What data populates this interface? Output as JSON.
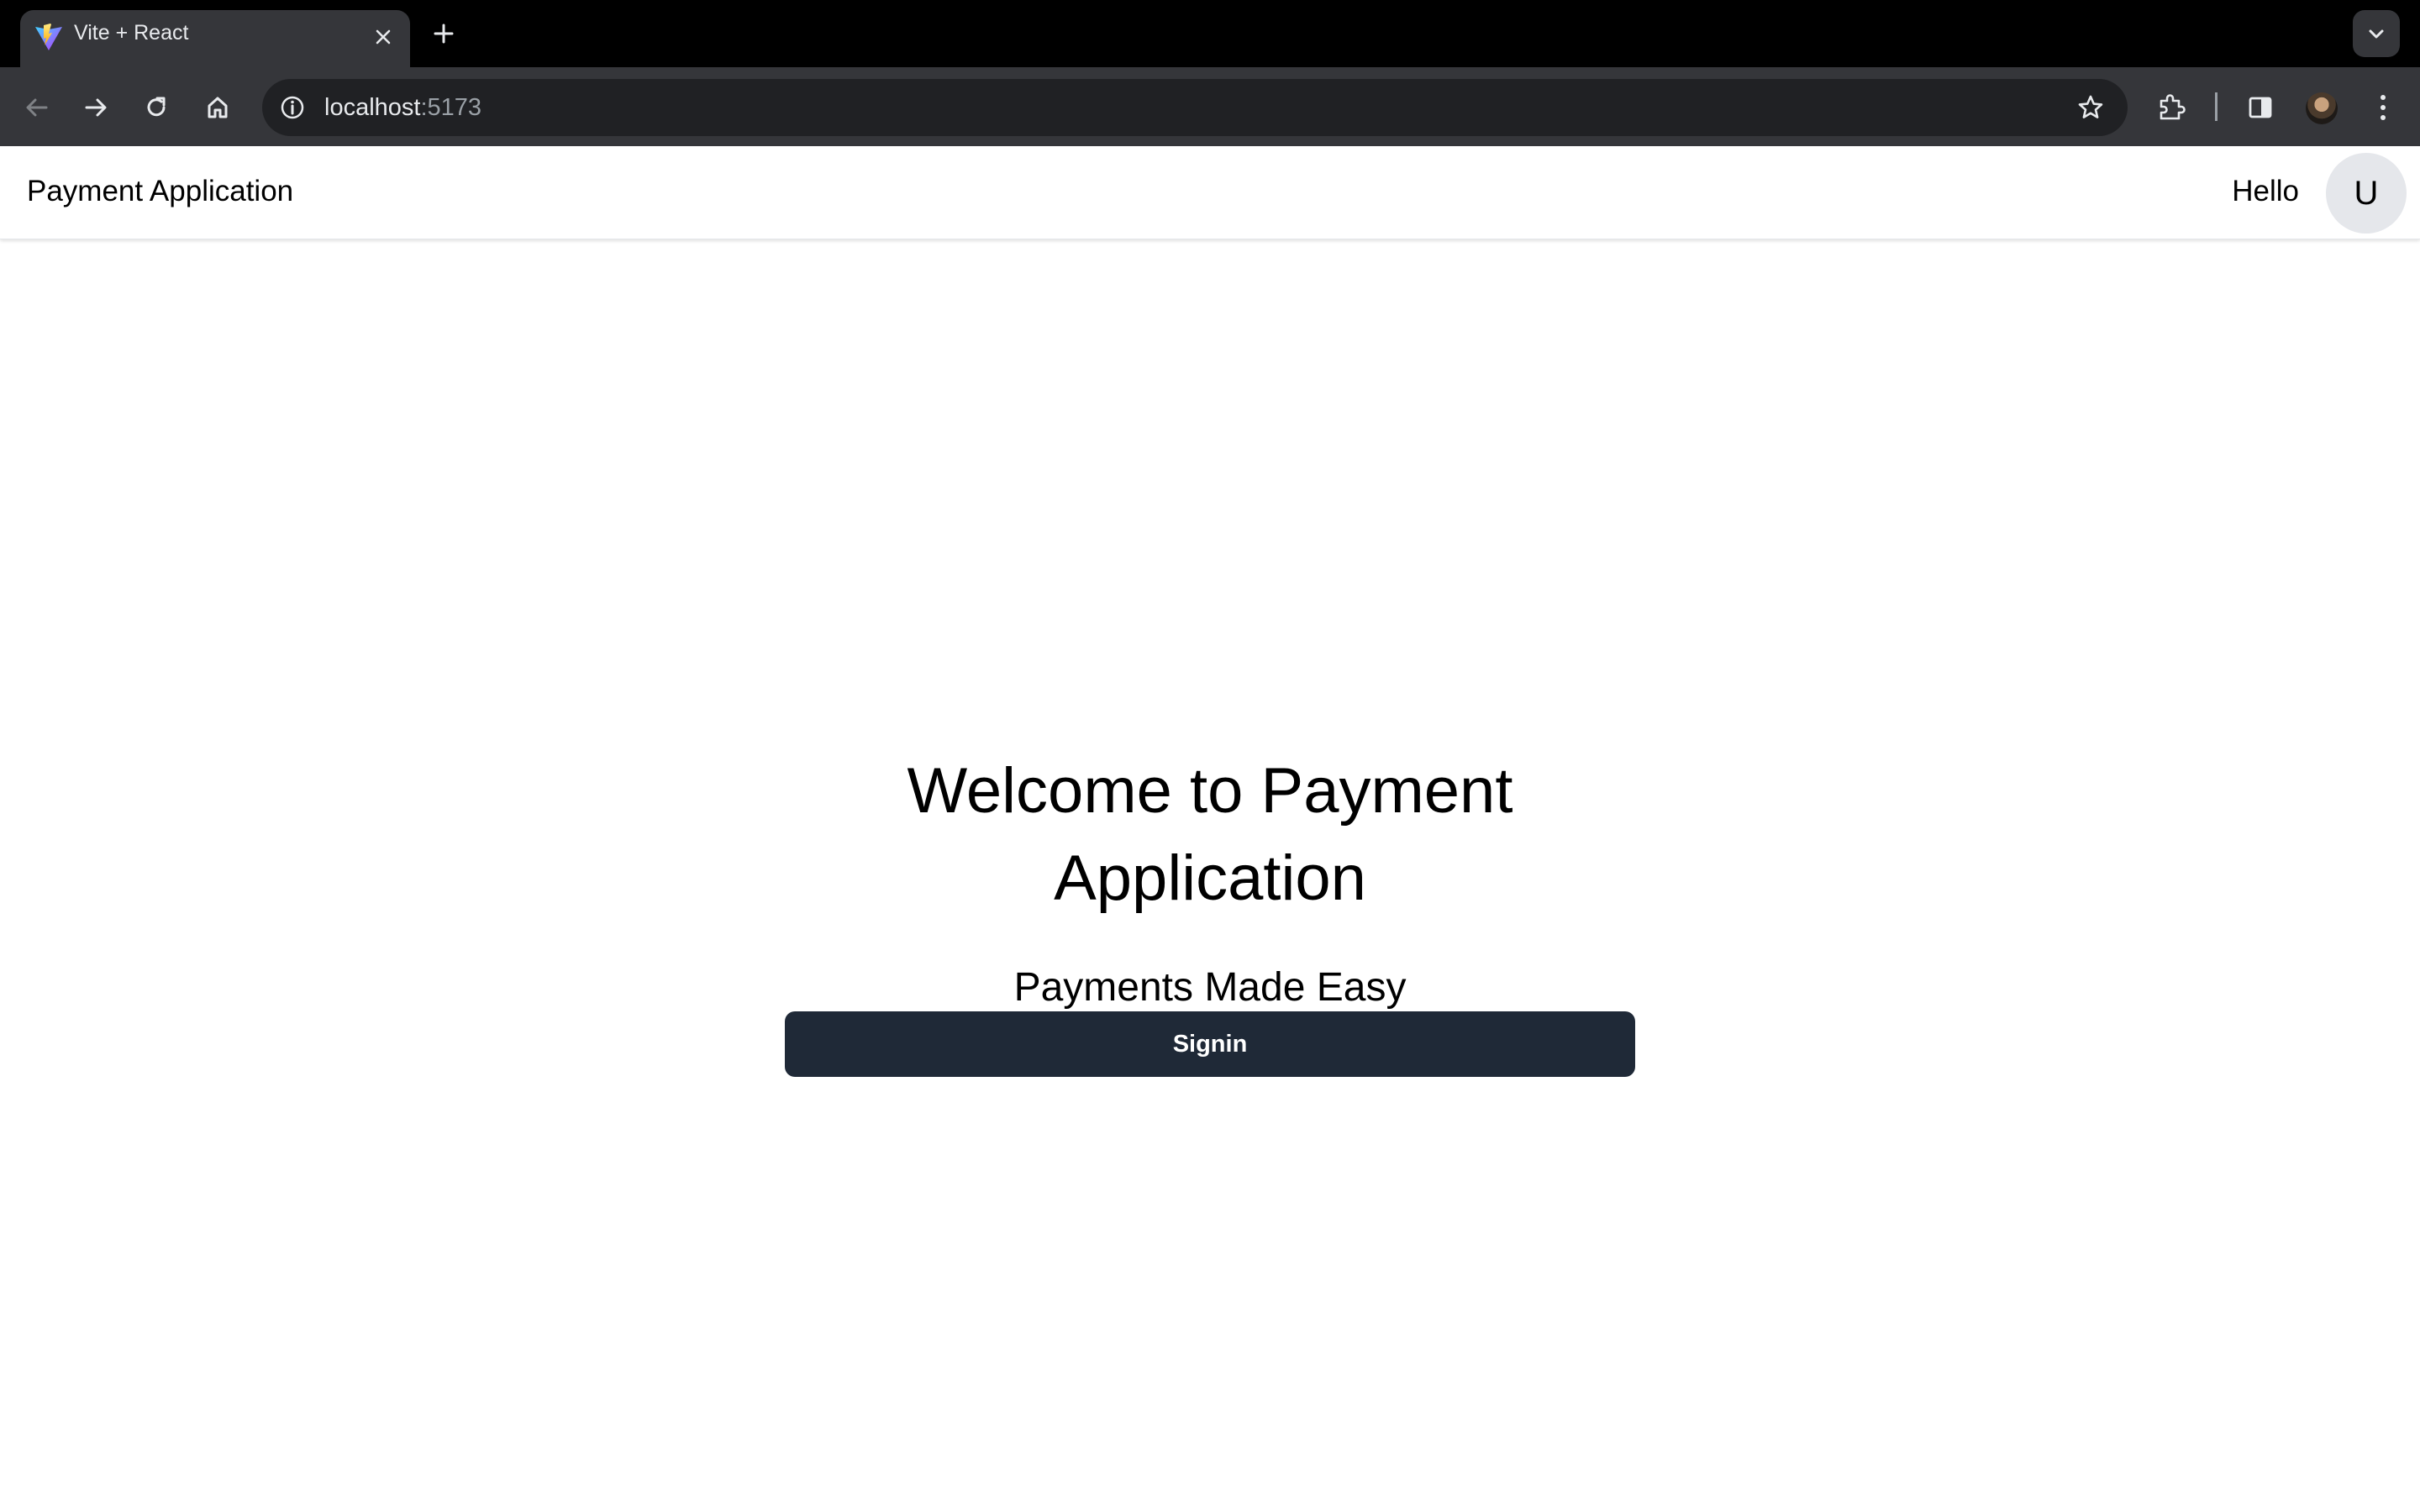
{
  "browser": {
    "tab": {
      "title": "Vite + React",
      "favicon": "vite-logo-icon"
    },
    "new_tab_icon": "plus-icon",
    "tab_search_icon": "chevron-down-icon",
    "nav": {
      "back_icon": "arrow-left-icon",
      "forward_icon": "arrow-right-icon",
      "reload_icon": "reload-icon",
      "home_icon": "home-icon"
    },
    "address": {
      "host": "localhost",
      "port": ":5173"
    },
    "actions": [
      "star-icon",
      "extensions-icon",
      "side-panel-icon",
      "profile-avatar",
      "kebab-menu-icon"
    ]
  },
  "header": {
    "title": "Payment Application",
    "greeting": "Hello",
    "avatar_initial": "U"
  },
  "hero": {
    "title": "Welcome to Payment Application",
    "subtitle": "Payments Made Easy",
    "signin_label": "Signin"
  },
  "colors": {
    "tab_strip_bg": "#000000",
    "toolbar_bg": "#35363a",
    "omnibox_bg": "#202124",
    "button_bg": "#1f2937",
    "avatar_bg": "#e5e7eb"
  }
}
